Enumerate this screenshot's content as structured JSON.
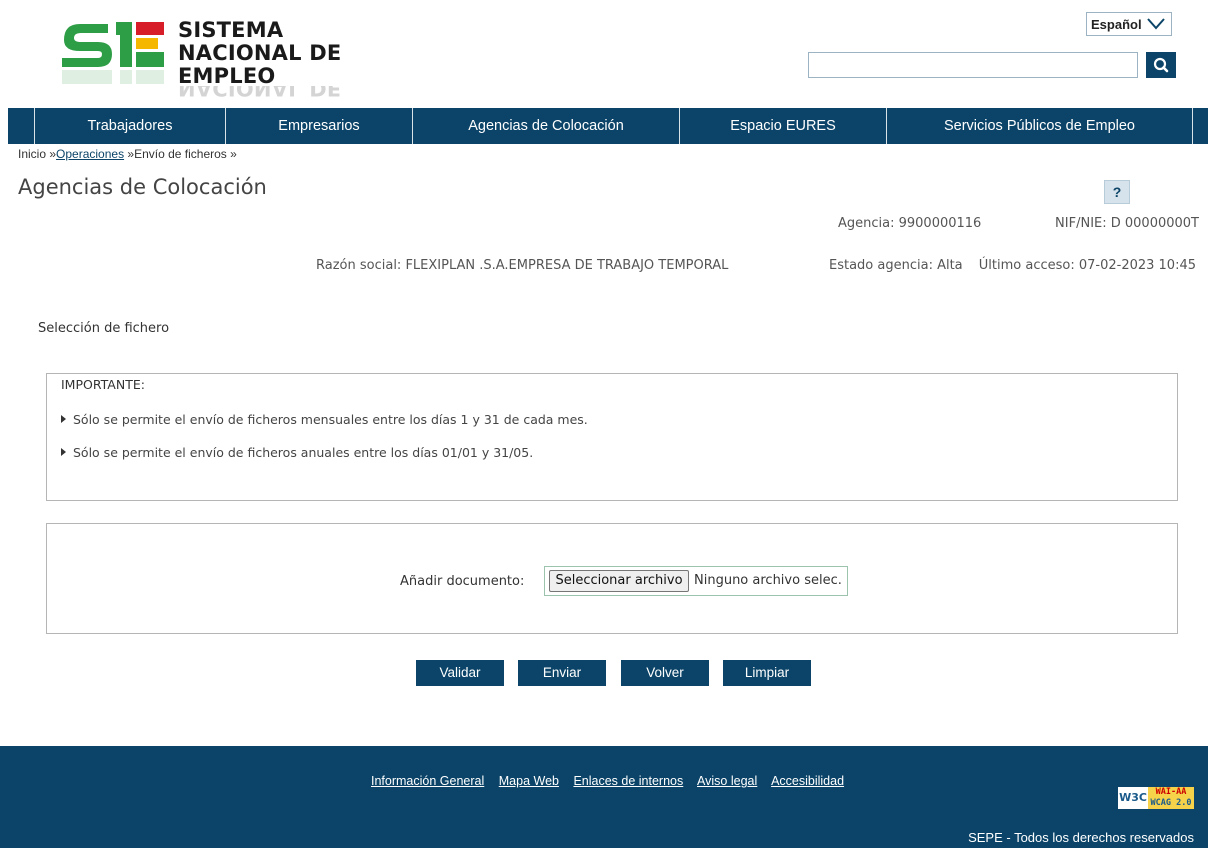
{
  "header": {
    "logo_line1": "SISTEMA",
    "logo_line2": "NACIONAL DE EMPLEO",
    "language": "Español",
    "search_placeholder": ""
  },
  "nav": {
    "items": [
      "Trabajadores",
      "Empresarios",
      "Agencias de Colocación",
      "Espacio EURES",
      "Servicios Públicos de Empleo"
    ]
  },
  "breadcrumb": {
    "home": "Inicio",
    "sep1": " »",
    "operaciones": "Operaciones",
    "sep2": " »Envío de ficheros »"
  },
  "page": {
    "title": "Agencias de Colocación",
    "help": "?"
  },
  "agency": {
    "agencia": "Agencia: 9900000116",
    "nif": "NIF/NIE: D 00000000T",
    "razon": "Razón social: FLEXIPLAN .S.A.EMPRESA DE TRABAJO TEMPORAL",
    "estado": "Estado agencia: Alta",
    "ultimo": "Último acceso: 07-02-2023 10:45"
  },
  "selection": {
    "title": "Selección de fichero",
    "important": "IMPORTANTE:",
    "notes": [
      "Sólo se permite el envío de ficheros mensuales entre los días 1 y 31 de cada mes.",
      "Sólo se permite el envío de ficheros anuales entre los días 01/01 y 31/05."
    ]
  },
  "upload": {
    "label": "Añadir documento:",
    "button": "Seleccionar archivo",
    "status": "Ninguno archivo selec."
  },
  "actions": {
    "validar": "Validar",
    "enviar": "Enviar",
    "volver": "Volver",
    "limpiar": "Limpiar"
  },
  "footer": {
    "links": [
      "Información General",
      "Mapa Web",
      "Enlaces de internos",
      "Aviso legal",
      "Accesibilidad"
    ],
    "badge_w3c": "W3C",
    "badge_wai": "WAI-AA",
    "badge_wcag": "WCAG 2.0",
    "copyright": "SEPE - Todos los derechos reservados"
  },
  "colors": {
    "brand": "#0b4468",
    "logo_green": "#2e9e46",
    "logo_red": "#d71e28",
    "logo_yellow": "#f5b700"
  }
}
